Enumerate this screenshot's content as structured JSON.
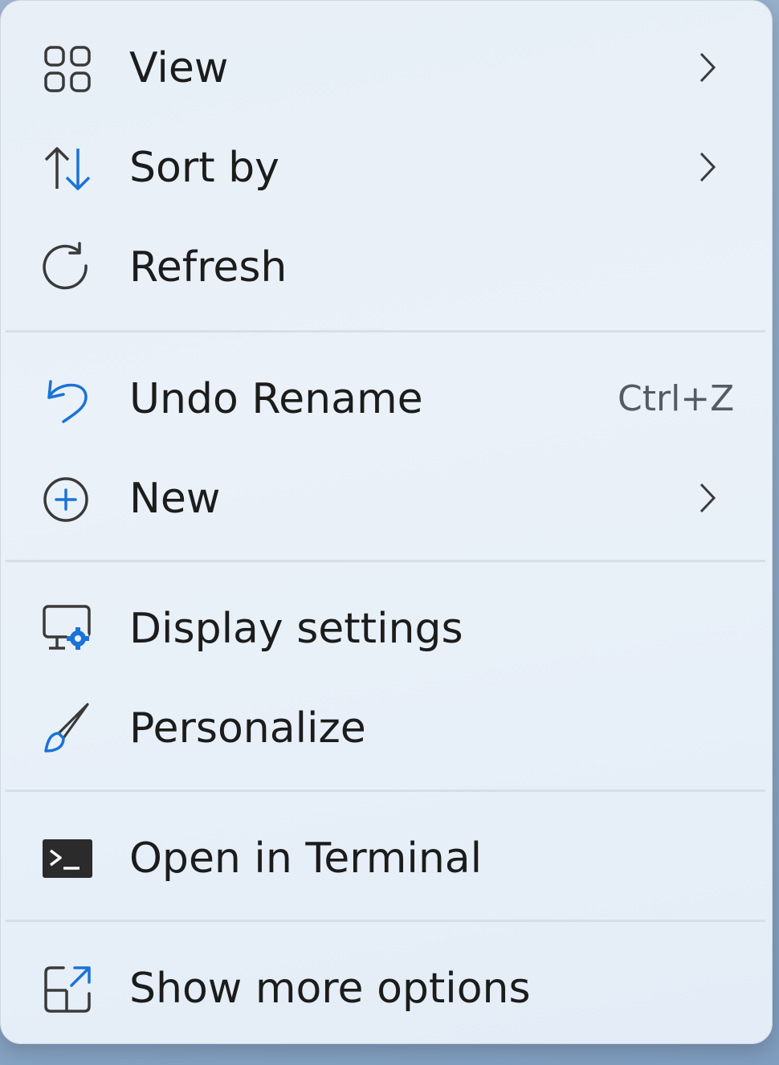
{
  "menu": {
    "items": [
      {
        "label": "View",
        "icon": "grid-view-icon",
        "has_submenu": true
      },
      {
        "label": "Sort by",
        "icon": "sort-arrows-icon",
        "has_submenu": true
      },
      {
        "label": "Refresh",
        "icon": "refresh-icon",
        "has_submenu": false
      },
      {
        "label": "Undo Rename",
        "icon": "undo-icon",
        "shortcut": "Ctrl+Z",
        "has_submenu": false
      },
      {
        "label": "New",
        "icon": "plus-circle-icon",
        "has_submenu": true
      },
      {
        "label": "Display settings",
        "icon": "display-settings-icon",
        "has_submenu": false
      },
      {
        "label": "Personalize",
        "icon": "brush-icon",
        "has_submenu": false
      },
      {
        "label": "Open in Terminal",
        "icon": "terminal-icon",
        "has_submenu": false
      },
      {
        "label": "Show more options",
        "icon": "share-external-icon",
        "has_submenu": false
      }
    ]
  },
  "colors": {
    "accent": "#1a73d6",
    "text": "#1c1c1c",
    "icon": "#3a3a3a"
  }
}
